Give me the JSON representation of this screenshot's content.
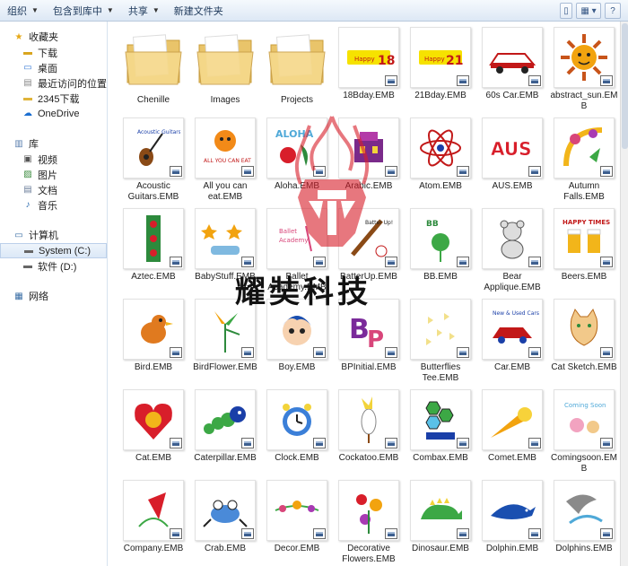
{
  "toolbar": {
    "organize": "组织",
    "include_in_library": "包含到库中",
    "share": "共享",
    "new_folder": "新建文件夹"
  },
  "sidebar": {
    "favorites": {
      "title": "收藏夹",
      "items": [
        {
          "label": "下载",
          "icon": "download-folder-icon"
        },
        {
          "label": "桌面",
          "icon": "desktop-icon"
        },
        {
          "label": "最近访问的位置",
          "icon": "recent-places-icon"
        },
        {
          "label": "2345下载",
          "icon": "folder-icon"
        },
        {
          "label": "OneDrive",
          "icon": "cloud-icon"
        }
      ]
    },
    "libraries": {
      "title": "库",
      "items": [
        {
          "label": "视频",
          "icon": "video-icon"
        },
        {
          "label": "图片",
          "icon": "pictures-icon"
        },
        {
          "label": "文档",
          "icon": "documents-icon"
        },
        {
          "label": "音乐",
          "icon": "music-icon"
        }
      ]
    },
    "computer": {
      "title": "计算机",
      "items": [
        {
          "label": "System (C:)",
          "icon": "drive-icon"
        },
        {
          "label": "软件 (D:)",
          "icon": "drive-icon"
        }
      ]
    },
    "network": {
      "title": "网络"
    }
  },
  "colors": {
    "accent": "#1e395b",
    "selection": "#dbe8f7"
  },
  "files": [
    {
      "name": "Chenille",
      "kind": "folder"
    },
    {
      "name": "Images",
      "kind": "folder"
    },
    {
      "name": "Projects",
      "kind": "folder"
    },
    {
      "name": "18Bday.EMB",
      "kind": "emb"
    },
    {
      "name": "21Bday.EMB",
      "kind": "emb"
    },
    {
      "name": "60s Car.EMB",
      "kind": "emb"
    },
    {
      "name": "abstract_sun.EMB",
      "kind": "emb"
    },
    {
      "name": "Acoustic Guitars.EMB",
      "kind": "emb"
    },
    {
      "name": "All you can eat.EMB",
      "kind": "emb"
    },
    {
      "name": "Aloha.EMB",
      "kind": "emb"
    },
    {
      "name": "Arabic.EMB",
      "kind": "emb"
    },
    {
      "name": "Atom.EMB",
      "kind": "emb"
    },
    {
      "name": "AUS.EMB",
      "kind": "emb"
    },
    {
      "name": "Autumn Falls.EMB",
      "kind": "emb"
    },
    {
      "name": "Aztec.EMB",
      "kind": "emb"
    },
    {
      "name": "BabyStuff.EMB",
      "kind": "emb"
    },
    {
      "name": "Ballet Academy.EMB",
      "kind": "emb"
    },
    {
      "name": "BatterUp.EMB",
      "kind": "emb"
    },
    {
      "name": "BB.EMB",
      "kind": "emb"
    },
    {
      "name": "Bear Applique.EMB",
      "kind": "emb"
    },
    {
      "name": "Beers.EMB",
      "kind": "emb"
    },
    {
      "name": "Bird.EMB",
      "kind": "emb"
    },
    {
      "name": "BirdFlower.EMB",
      "kind": "emb"
    },
    {
      "name": "Boy.EMB",
      "kind": "emb"
    },
    {
      "name": "BPInitial.EMB",
      "kind": "emb"
    },
    {
      "name": "Butterflies Tee.EMB",
      "kind": "emb"
    },
    {
      "name": "Car.EMB",
      "kind": "emb"
    },
    {
      "name": "Cat Sketch.EMB",
      "kind": "emb"
    },
    {
      "name": "Cat.EMB",
      "kind": "emb"
    },
    {
      "name": "Caterpillar.EMB",
      "kind": "emb"
    },
    {
      "name": "Clock.EMB",
      "kind": "emb"
    },
    {
      "name": "Cockatoo.EMB",
      "kind": "emb"
    },
    {
      "name": "Combax.EMB",
      "kind": "emb"
    },
    {
      "name": "Comet.EMB",
      "kind": "emb"
    },
    {
      "name": "Comingsoon.EMB",
      "kind": "emb"
    },
    {
      "name": "Company.EMB",
      "kind": "emb"
    },
    {
      "name": "Crab.EMB",
      "kind": "emb"
    },
    {
      "name": "Decor.EMB",
      "kind": "emb"
    },
    {
      "name": "Decorative Flowers.EMB",
      "kind": "emb"
    },
    {
      "name": "Dinosaur.EMB",
      "kind": "emb"
    },
    {
      "name": "Dolphin.EMB",
      "kind": "emb"
    },
    {
      "name": "Dolphins.EMB",
      "kind": "emb"
    }
  ],
  "thumb_text": {
    "bday18": "Happy 18",
    "bday21": "Happy 21",
    "aus": "AUS",
    "aloha": "ALOHA",
    "bp": "BP",
    "beers": "HAPPY TIMES",
    "allyoucan": "ALL YOU CAN EAT"
  },
  "watermark": {
    "text": "耀奘科技"
  }
}
